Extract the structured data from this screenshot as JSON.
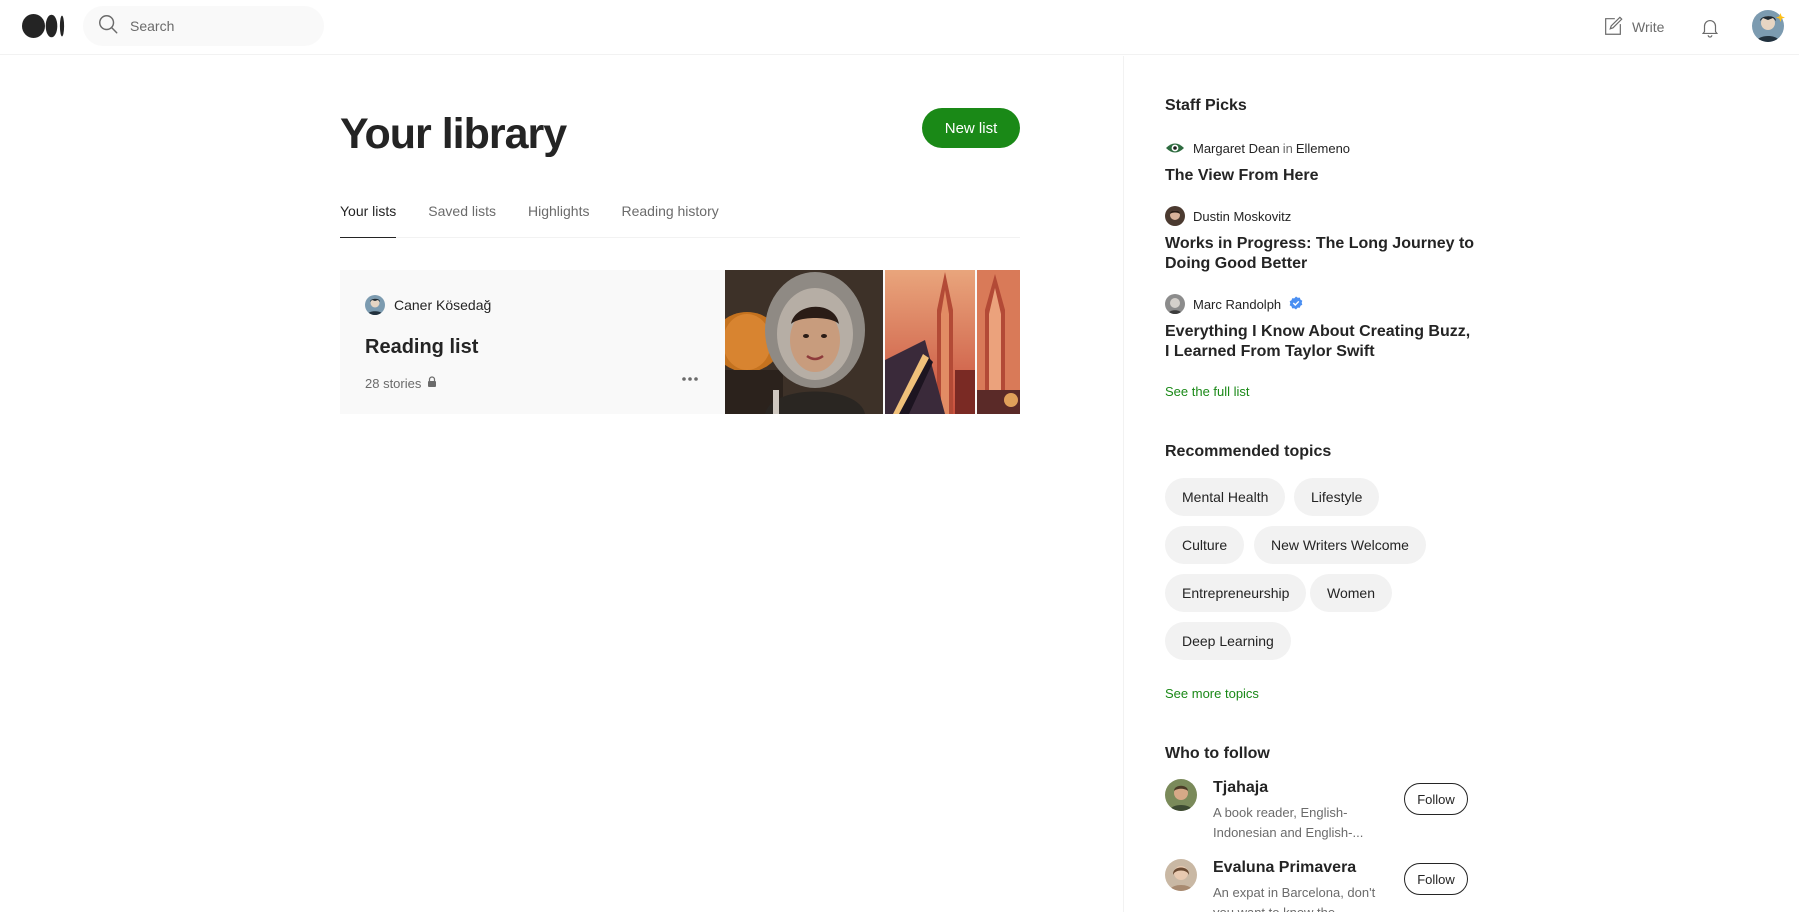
{
  "header": {
    "search_placeholder": "Search",
    "write_label": "Write",
    "icons": [
      "medium-logo-icon",
      "search-icon",
      "write-icon",
      "bell-icon"
    ]
  },
  "library": {
    "title": "Your library",
    "new_list_label": "New list",
    "tabs": [
      {
        "label": "Your lists",
        "active": true
      },
      {
        "label": "Saved lists",
        "active": false
      },
      {
        "label": "Highlights",
        "active": false
      },
      {
        "label": "Reading history",
        "active": false
      }
    ],
    "list_card": {
      "author": "Caner Kösedağ",
      "title": "Reading list",
      "meta": "28 stories",
      "private": true
    }
  },
  "sidebar": {
    "staff_picks": {
      "title": "Staff Picks",
      "items": [
        {
          "author": "Margaret Dean",
          "connector": "in",
          "publication": "Ellemeno",
          "title": "The View From Here"
        },
        {
          "author": "Dustin Moskovitz",
          "title": "Works in Progress: The Long Journey to Doing Good Better"
        },
        {
          "author": "Marc Randolph",
          "verified": true,
          "title": "Everything I Know About Creating Buzz, I Learned From Taylor Swift"
        }
      ],
      "see_full_list": "See the full list"
    },
    "recommended_topics": {
      "title": "Recommended topics",
      "topics": [
        "Mental Health",
        "Lifestyle",
        "Culture",
        "New Writers Welcome",
        "Entrepreneurship",
        "Women",
        "Deep Learning"
      ],
      "see_more": "See more topics"
    },
    "who_to_follow": {
      "title": "Who to follow",
      "people": [
        {
          "name": "Tjahaja",
          "bio": "A book reader, English-Indonesian and English-...",
          "button": "Follow"
        },
        {
          "name": "Evaluna Primavera",
          "bio": "An expat in Barcelona, don't you want to know the secrets...",
          "button": "Follow"
        }
      ]
    }
  },
  "colors": {
    "accent_green": "#1a8917",
    "text_primary": "#242424",
    "text_muted": "#6b6b6b",
    "card_bg": "#f9f9f9",
    "chip_bg": "#f2f2f2",
    "verified_blue": "#4a8ff2"
  }
}
